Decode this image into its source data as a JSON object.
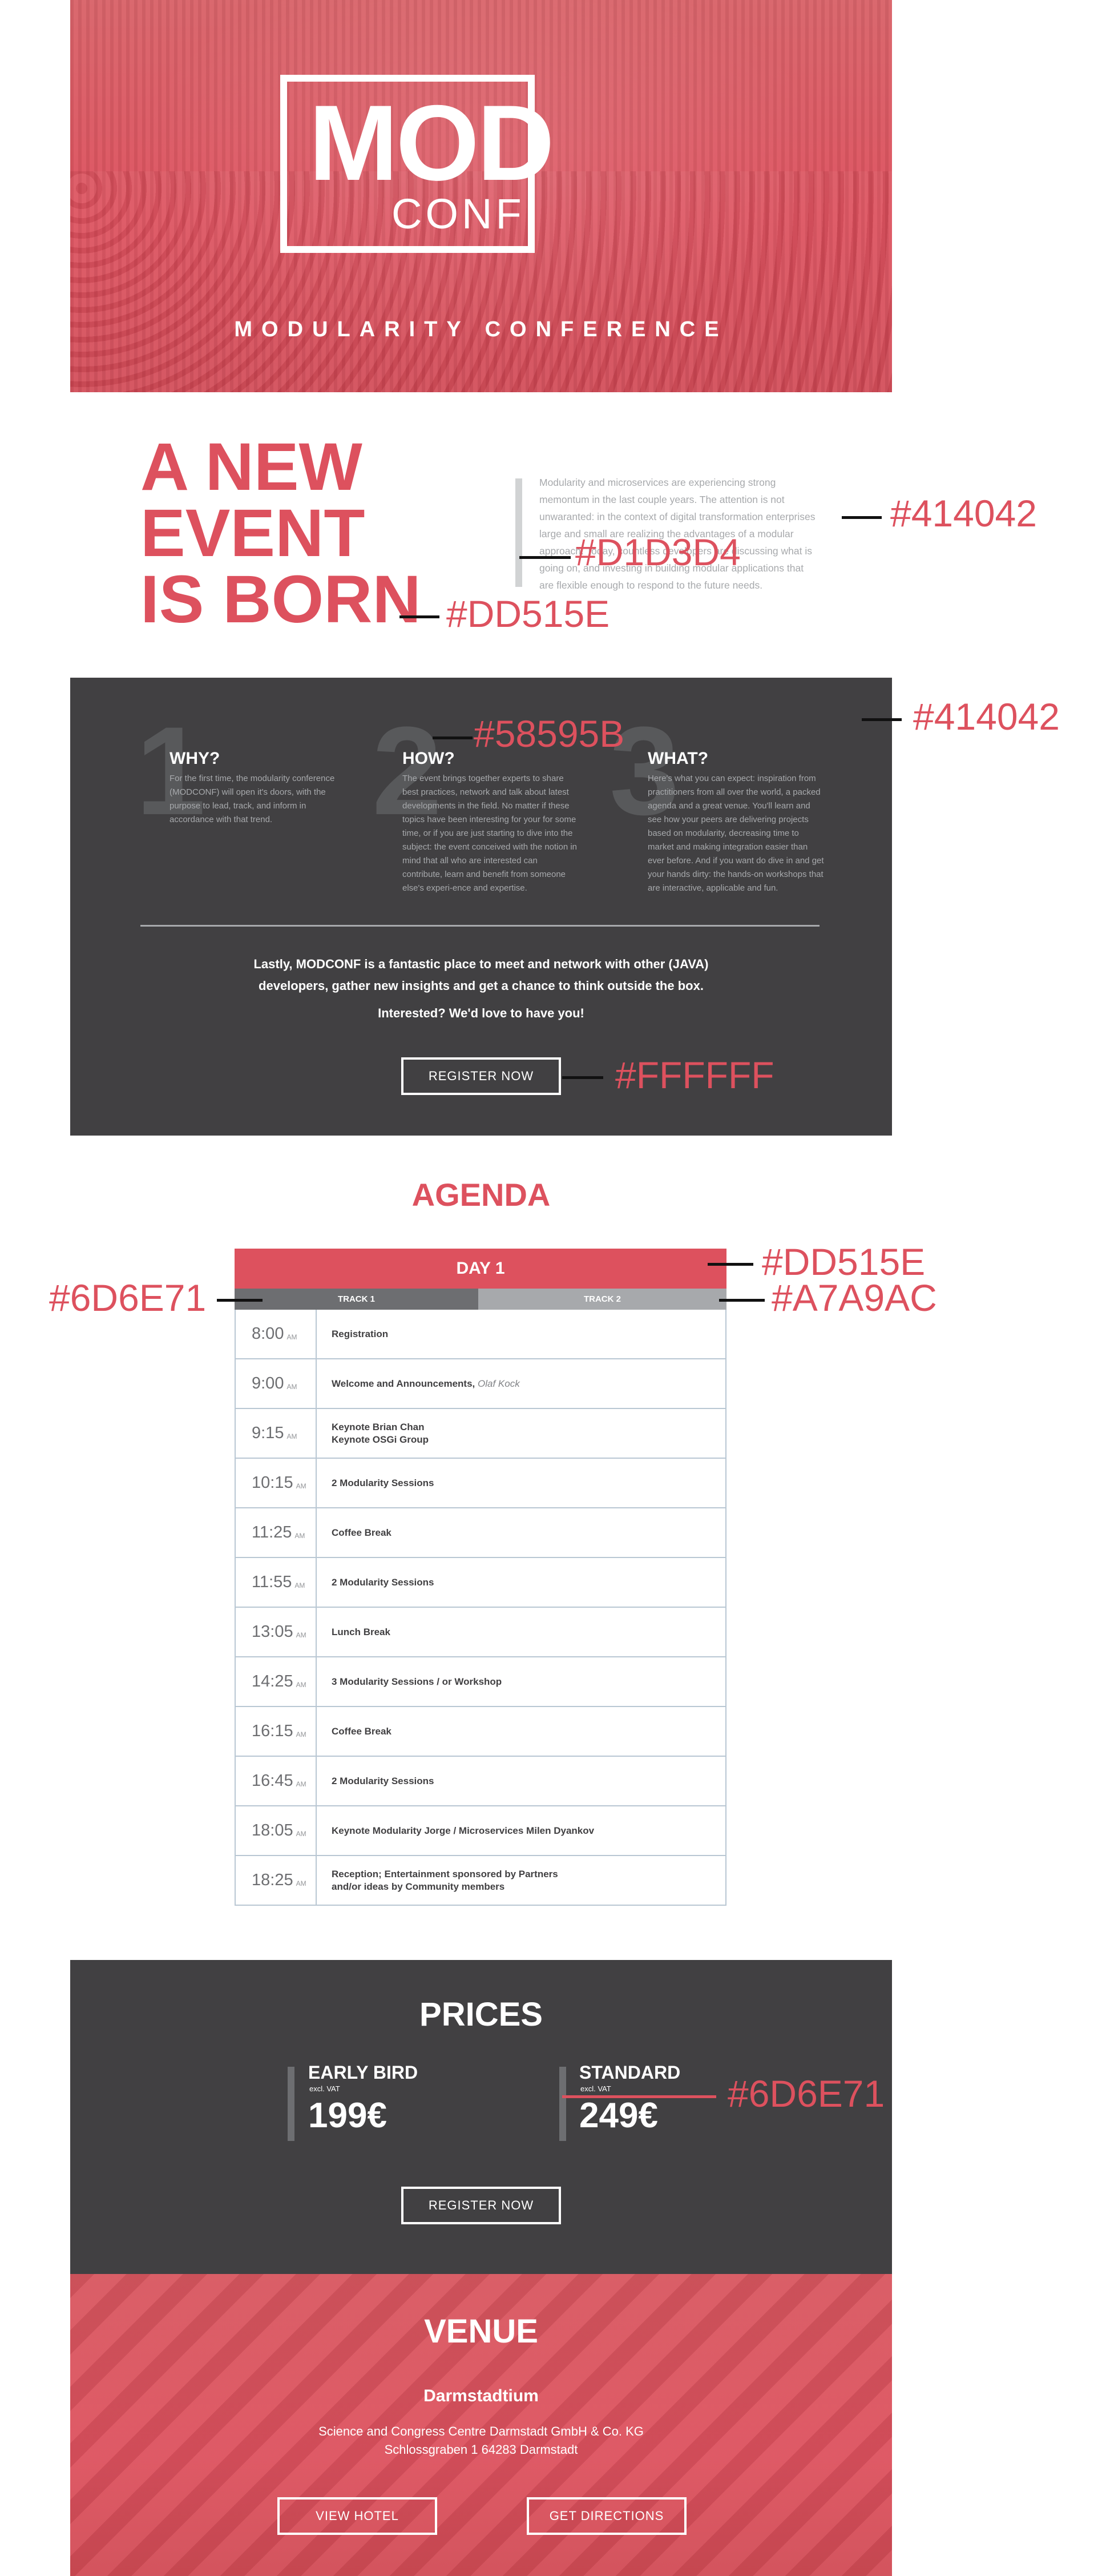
{
  "hero": {
    "logo_main": "MOD",
    "logo_sub": "CONF",
    "subtitle": "MODULARITY CONFERENCE"
  },
  "intro": {
    "heading_lines": [
      "A NEW",
      "EVENT",
      "IS BORN"
    ],
    "text": "Modularity and microservices are experiencing strong memontum in the last couple years. The attention is not unwaranted: in the context of digital transformation enterprises large and small are realizing the advantages of a modular approach. Today, countless developers are discussing what is going on, and investing in building modular applications that are flexible enough to respond to the future needs."
  },
  "annotations": {
    "intro_text_color": "#414042",
    "intro_bar_color": "#D1D3D4",
    "heading_color": "#DD515E",
    "number_color": "#58595B",
    "about_bg_color": "#414042",
    "button_color": "#FFFFFF",
    "day_color": "#DD515E",
    "track1_color": "#6D6E71",
    "track2_color": "#A7A9AC",
    "price_bar_color": "#6D6E71"
  },
  "about": {
    "columns": [
      {
        "number": "1",
        "title": "WHY?",
        "text": "For the first time, the modularity conference (MODCONF) will open it's doors, with the purpose to lead, track, and inform in accordance with that trend."
      },
      {
        "number": "2",
        "title": "HOW?",
        "text": "The event brings together experts to share best practices, network and talk about latest developments in the field. No matter if these topics have been interesting for your for some time, or if you are just starting to dive into the subject: the event conceived with the notion in mind that all who are interested can contribute, learn and benefit from someone else's experi-ence and expertise."
      },
      {
        "number": "3",
        "title": "WHAT?",
        "text": "Here's what you can expect: inspiration from practitioners from all over the world, a packed agenda and a great venue. You'll learn and see how your peers are delivering projects based on modularity, decreasing time to market and making integration easier than ever before. And if you want do dive in and get your hands dirty: the hands-on workshops that are interactive, applicable and fun."
      }
    ],
    "closing_line1": "Lastly, MODCONF is a fantastic place to meet and network with other (JAVA)",
    "closing_line2": "developers, gather new insights and get a chance to think outside the box.",
    "interested": "Interested? We'd love to have you!",
    "register_label": "REGISTER NOW"
  },
  "agenda": {
    "title": "AGENDA",
    "day": "DAY 1",
    "track1": "TRACK 1",
    "track2": "TRACK 2",
    "rows": [
      {
        "time": "8:00",
        "ampm": "AM",
        "event": "Registration",
        "note": ""
      },
      {
        "time": "9:00",
        "ampm": "AM",
        "event": "Welcome and Announcements,",
        "note": "Olaf Kock"
      },
      {
        "time": "9:15",
        "ampm": "AM",
        "event": "Keynote Brian Chan",
        "event2": "Keynote OSGi Group",
        "note": ""
      },
      {
        "time": "10:15",
        "ampm": "AM",
        "event": "2 Modularity Sessions",
        "note": ""
      },
      {
        "time": "11:25",
        "ampm": "AM",
        "event": "Coffee Break",
        "note": ""
      },
      {
        "time": "11:55",
        "ampm": "AM",
        "event": "2 Modularity Sessions",
        "note": ""
      },
      {
        "time": "13:05",
        "ampm": "AM",
        "event": "Lunch Break",
        "note": ""
      },
      {
        "time": "14:25",
        "ampm": "AM",
        "event": "3 Modularity Sessions / or Workshop",
        "note": ""
      },
      {
        "time": "16:15",
        "ampm": "AM",
        "event": "Coffee Break",
        "note": ""
      },
      {
        "time": "16:45",
        "ampm": "AM",
        "event": "2 Modularity Sessions",
        "note": ""
      },
      {
        "time": "18:05",
        "ampm": "AM",
        "event": "Keynote Modularity Jorge / Microservices Milen Dyankov",
        "note": ""
      },
      {
        "time": "18:25",
        "ampm": "AM",
        "event": "Reception; Entertainment sponsored by Partners",
        "event2": "and/or ideas by Community members",
        "note": ""
      }
    ]
  },
  "prices": {
    "title": "PRICES",
    "early_name": "EARLY BIRD",
    "early_vat": "excl. VAT",
    "early_amount": "199€",
    "standard_name": "STANDARD",
    "standard_vat": "excl. VAT",
    "standard_amount": "249€",
    "register_label": "REGISTER NOW"
  },
  "venue": {
    "title": "VENUE",
    "name": "Darmstadtium",
    "address_line1": "Science and Congress Centre Darmstadt GmbH & Co. KG",
    "address_line2": "Schlossgraben 1 64283 Darmstadt",
    "hotel_label": "VIEW HOTEL",
    "directions_label": "GET DIRECTIONS"
  }
}
